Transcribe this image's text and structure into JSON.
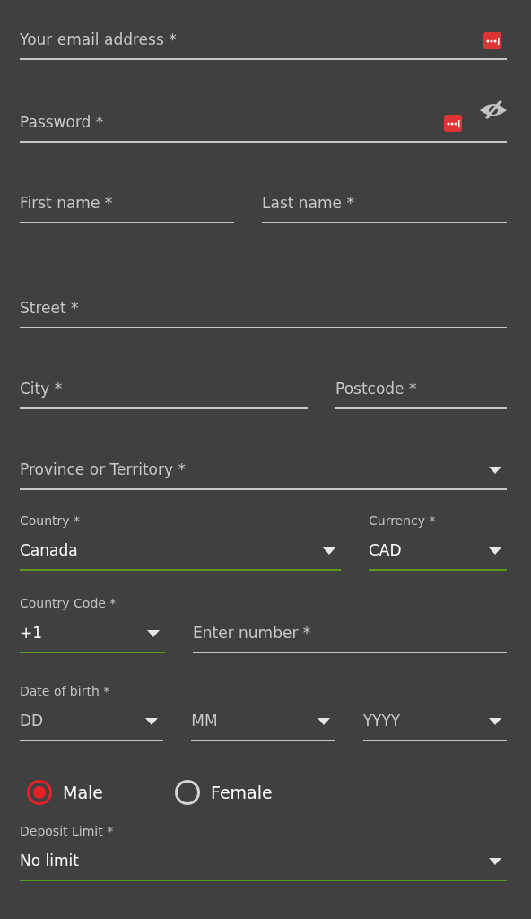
{
  "rows": [
    {
      "fields": [
        {
          "kind": "email",
          "placeholder": "Your email address *"
        }
      ]
    },
    {
      "fields": [
        {
          "kind": "password",
          "placeholder": "Password *"
        }
      ]
    },
    {
      "fields": [
        {
          "kind": "text",
          "placeholder": "First name *"
        },
        {
          "kind": "text",
          "placeholder": "Last name *"
        }
      ]
    },
    {
      "fields": [
        {
          "kind": "text",
          "placeholder": "Street *"
        }
      ]
    },
    {
      "fields": [
        {
          "kind": "text",
          "placeholder": "City *"
        },
        {
          "kind": "text",
          "placeholder": "Postcode *"
        }
      ]
    },
    {
      "fields": [
        {
          "kind": "select",
          "placeholder": "Province or Territory *"
        }
      ]
    },
    {
      "fields": [
        {
          "kind": "select",
          "label": "Country *",
          "value": "Canada"
        },
        {
          "kind": "select",
          "label": "Currency *",
          "value": "CAD"
        }
      ]
    },
    {
      "fields": [
        {
          "kind": "select",
          "label": "Country Code *",
          "value": "+1"
        },
        {
          "kind": "text",
          "placeholder": "Enter number *"
        }
      ]
    },
    {
      "label": "Date of birth *",
      "fields": [
        {
          "kind": "select",
          "placeholder": "DD"
        },
        {
          "kind": "select",
          "placeholder": "MM"
        },
        {
          "kind": "select",
          "placeholder": "YYYY"
        }
      ]
    }
  ],
  "gender": [
    {
      "label": "Male",
      "selected": true
    },
    {
      "label": "Female",
      "selected": false
    }
  ],
  "deposit_limit": {
    "kind": "select",
    "label": "Deposit Limit *",
    "value": "No limit"
  }
}
